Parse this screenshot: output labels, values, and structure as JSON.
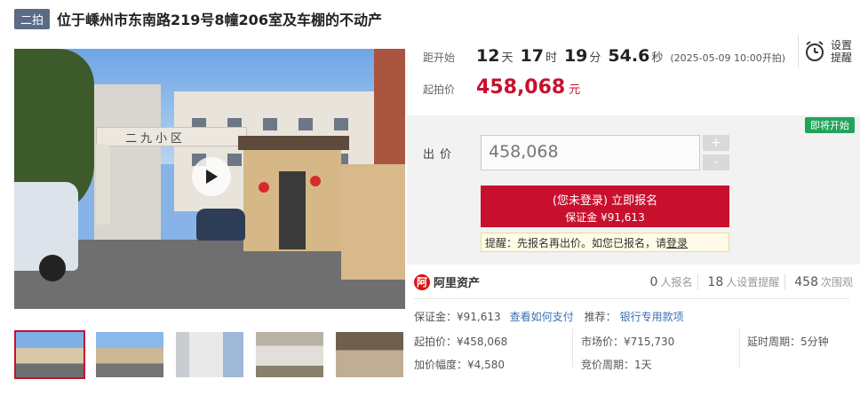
{
  "header": {
    "badge": "二拍",
    "title": "位于嵊州市东南路219号8幢206室及车棚的不动产"
  },
  "media": {
    "play_label": "play",
    "gate_text": "二九小区",
    "thumbnail_count": 5
  },
  "countdown": {
    "label": "距开始",
    "days": "12",
    "days_unit": "天",
    "hours": "17",
    "hours_unit": "时",
    "minutes": "19",
    "minutes_unit": "分",
    "seconds": "54.6",
    "seconds_unit": "秒",
    "start_note": "(2025-05-09 10:00开拍)"
  },
  "reminder": {
    "line1": "设置",
    "line2": "提醒"
  },
  "start_price": {
    "label": "起拍价",
    "value": "458,068",
    "unit": "元"
  },
  "bid": {
    "tag": "即将开始",
    "label": "出价",
    "value": "458,068",
    "plus": "+",
    "minus": "-",
    "signup_line1": "(您未登录) 立即报名",
    "signup_line2": "保证金 ¥91,613",
    "tip_text": "提醒：先报名再出价。如您已报名，请",
    "tip_link": "登录"
  },
  "stats": {
    "brand": "阿里资产",
    "brand_icon": "阿",
    "signups": "0",
    "signups_unit": "人报名",
    "reminders": "18",
    "reminders_unit": "人设置提醒",
    "views": "458",
    "views_unit": "次围观"
  },
  "deposit": {
    "label": "保证金：¥91,613",
    "pay_link": "查看如何支付",
    "recommend": "推荐：",
    "bank_link": "银行专用款项"
  },
  "details": {
    "start_price": "起拍价：¥458,068",
    "market_price": "市场价：¥715,730",
    "delay": "延时周期：5分钟",
    "increment": "加价幅度：¥4,580",
    "bid_period": "竞价周期：1天"
  },
  "colors": {
    "accent": "#c8102e",
    "badge": "#5a6b86",
    "tag": "#22a35a",
    "link": "#3a6fb6"
  }
}
